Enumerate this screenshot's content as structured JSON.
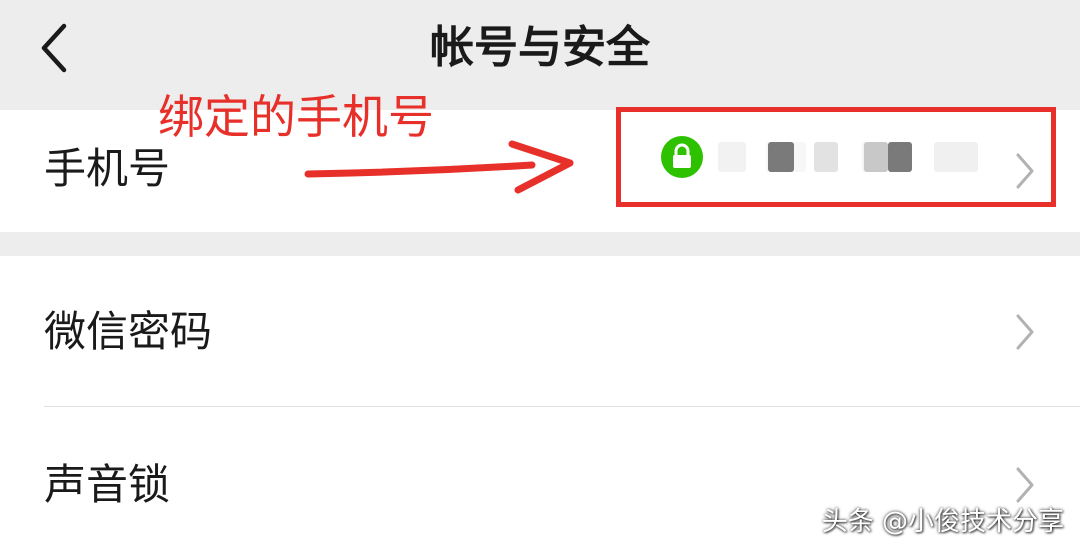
{
  "header": {
    "title": "帐号与安全",
    "back_icon": "chevron-left-icon"
  },
  "settings": {
    "phone": {
      "label": "手机号",
      "value_masked": true,
      "bound_icon": "lock-icon",
      "bound_color": "#2dc100"
    },
    "items": [
      {
        "label": "微信密码"
      },
      {
        "label": "声音锁"
      }
    ]
  },
  "annotation": {
    "text": "绑定的手机号",
    "color": "#e8302a"
  },
  "watermark": {
    "text": "头条 @小俊技术分享"
  }
}
